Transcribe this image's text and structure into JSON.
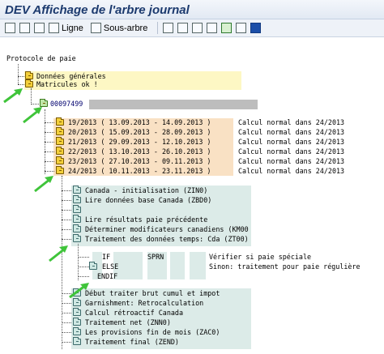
{
  "window": {
    "title": "DEV Affichage de l'arbre journal"
  },
  "toolbar": {
    "ligne_label": "Ligne",
    "sous_arbre_label": "Sous-arbre",
    "icons": [
      "expand-all-icon",
      "collapse-all-icon",
      "choose-icon",
      "find-icon",
      "list-icon",
      "settings-icon",
      "print-icon",
      "save-icon",
      "export-icon",
      "info-icon"
    ]
  },
  "tree": {
    "root": "Protocole de paie",
    "level1": [
      {
        "label": "Données générales"
      },
      {
        "label": "Matricules ok !"
      }
    ],
    "employee": {
      "label": "00097499"
    },
    "periods": [
      {
        "period": "19/2013 ( 13.09.2013 - 14.09.2013 )",
        "text": "Calcul normal dans 24/2013"
      },
      {
        "period": "20/2013 ( 15.09.2013 - 28.09.2013 )",
        "text": "Calcul normal dans 24/2013"
      },
      {
        "period": "21/2013 ( 29.09.2013 - 12.10.2013 )",
        "text": "Calcul normal dans 24/2013"
      },
      {
        "period": "22/2013 ( 13.10.2013 - 26.10.2013 )",
        "text": "Calcul normal dans 24/2013"
      },
      {
        "period": "23/2013 ( 27.10.2013 - 09.11.2013 )",
        "text": "Calcul normal dans 24/2013"
      },
      {
        "period": "24/2013 ( 10.11.2013 - 23.11.2013 )",
        "text": "Calcul normal dans 24/2013"
      }
    ],
    "steps": [
      {
        "label": "Canada - initialisation (ZIN0)"
      },
      {
        "label": "Lire données base Canada (ZBD0)"
      },
      {
        "label": ""
      },
      {
        "label": "Lire résultats paie précédente"
      },
      {
        "label": "Déterminer modificateurs canadiens (KM00"
      },
      {
        "label": "Traitement des données temps: Cda (ZT00)"
      }
    ],
    "rules": [
      {
        "op": "IF",
        "arg": "SPRN",
        "comment": "Vérifier si paie spéciale"
      },
      {
        "op": "ELSE",
        "arg": "",
        "comment": "Sinon: traitement pour paie régulière"
      },
      {
        "op": "ENDIF",
        "arg": "",
        "comment": ""
      }
    ],
    "steps2": [
      {
        "label": "Début traiter brut cumul et impot"
      },
      {
        "label": "Garnishment: Retrocalculation"
      },
      {
        "label": "Calcul rétroactif Canada"
      },
      {
        "label": "Traitement net (ZNN0)"
      },
      {
        "label": "Les provisions fin de mois (ZAC0)"
      },
      {
        "label": "Traitement final (ZEND)"
      }
    ]
  },
  "colors": {
    "yellow_highlight": "#fdf7c4",
    "peach_highlight": "#f9e1c4",
    "teal_highlight": "#dcebe8",
    "arrow_green": "#3fc43a"
  }
}
